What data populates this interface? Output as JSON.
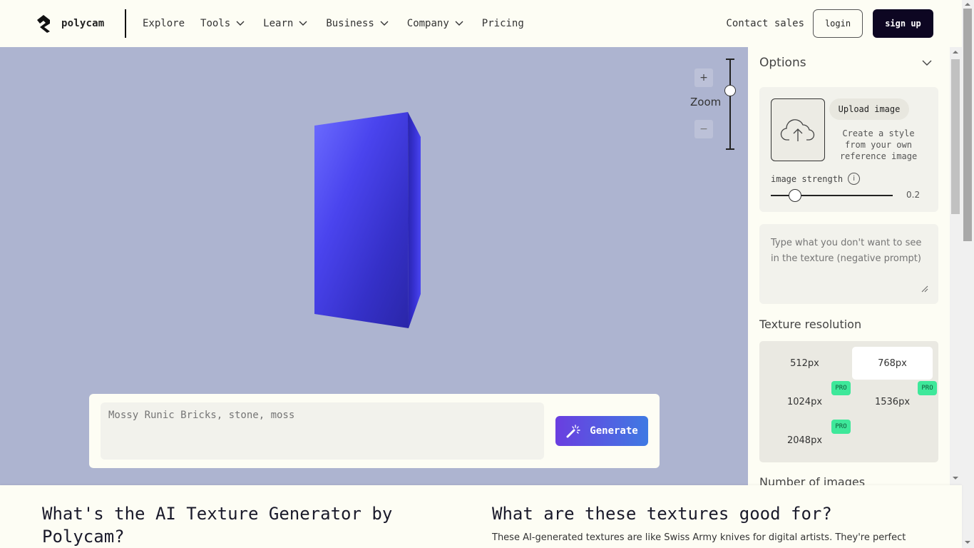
{
  "header": {
    "logo_text": "polycam",
    "nav": [
      {
        "label": "Explore",
        "has_dropdown": false
      },
      {
        "label": "Tools",
        "has_dropdown": true
      },
      {
        "label": "Learn",
        "has_dropdown": true
      },
      {
        "label": "Business",
        "has_dropdown": true
      },
      {
        "label": "Company",
        "has_dropdown": true
      },
      {
        "label": "Pricing",
        "has_dropdown": false
      }
    ],
    "contact_label": "Contact sales",
    "login_label": "login",
    "signup_label": "sign up"
  },
  "viewport": {
    "zoom_label": "Zoom",
    "zoom_plus": "+",
    "zoom_minus": "−",
    "zoom_level": 0.65,
    "preview_color": "#3b35d8",
    "background_color": "#adb4d0"
  },
  "prompt": {
    "placeholder": "Mossy Runic Bricks, stone, moss",
    "value": "",
    "generate_label": "Generate",
    "generate_icon": "magic-wand-icon"
  },
  "options": {
    "title": "Options",
    "upload_label": "Upload image",
    "upload_icon": "cloud-upload-icon",
    "upload_description": "Create a style from your own reference image",
    "strength_label": "image strength",
    "strength_info_icon": "info-icon",
    "strength_value": "0.2",
    "strength_fraction": 0.2,
    "negative_prompt_placeholder": "Type what you don't want to see in the texture (negative prompt)",
    "resolution_title": "Texture resolution",
    "resolutions": [
      {
        "label": "512px",
        "pro": false,
        "selected": false
      },
      {
        "label": "768px",
        "pro": false,
        "selected": true
      },
      {
        "label": "1024px",
        "pro": true,
        "selected": false
      },
      {
        "label": "1536px",
        "pro": true,
        "selected": false
      },
      {
        "label": "2048px",
        "pro": true,
        "selected": false
      }
    ],
    "pro_badge": "PRO",
    "number_of_images_title": "Number of images"
  },
  "content": {
    "left_heading": "What's the AI Texture Generator by Polycam?",
    "right_heading": "What are these textures good for?",
    "right_paragraph": "These AI-generated textures are like Swiss Army knives for digital artists. They're perfect"
  },
  "colors": {
    "brand_dark": "#0d0622",
    "generate_gradient_start": "#6a3ee0",
    "generate_gradient_end": "#3f7ae3",
    "pro_badge": "#3ee89a"
  }
}
